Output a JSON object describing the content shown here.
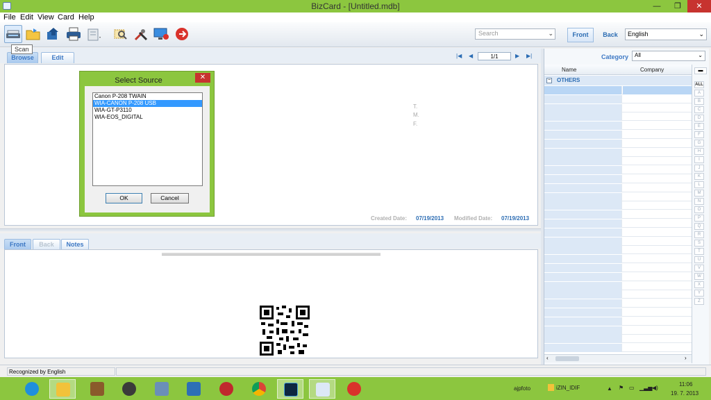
{
  "window": {
    "title": "BizCard - [Untitled.mdb]",
    "close_glyph": "✕",
    "minimize_glyph": "—",
    "maximize_glyph": "❐"
  },
  "menu": [
    "File",
    "Edit",
    "View",
    "Card",
    "Help"
  ],
  "toolbar": {
    "tooltip": "Scan",
    "search_placeholder": "Search",
    "front_label": "Front",
    "back_label": "Back",
    "language": "English"
  },
  "card_view": {
    "tabs": [
      "Browse",
      "Edit"
    ],
    "pager": "1/1",
    "field_labels": [
      "T.",
      "M.",
      "F."
    ],
    "created_label": "Created Date:",
    "created_value": "07/19/2013",
    "modified_label": "Modified Date:",
    "modified_value": "07/19/2013"
  },
  "bottom_tabs": [
    "Front",
    "Back",
    "Notes"
  ],
  "dialog": {
    "title": "Select Source",
    "sources": [
      "Canon P-208 TWAIN",
      "WIA-CANON P-208 USB",
      "WIA-GT-P3110",
      "WIA-EOS_DIGITAL"
    ],
    "selected_index": 1,
    "ok_label": "OK",
    "cancel_label": "Cancel"
  },
  "right_panel": {
    "category_label": "Category",
    "category_value": "All",
    "columns": [
      "Name",
      "Company"
    ],
    "group": "OTHERS",
    "alphabet": [
      "ALL",
      "A",
      "B",
      "C",
      "D",
      "E",
      "F",
      "G",
      "H",
      "I",
      "J",
      "K",
      "L",
      "M",
      "N",
      "O",
      "P",
      "Q",
      "R",
      "S",
      "T",
      "U",
      "V",
      "W",
      "X",
      "Y",
      "Z"
    ]
  },
  "status": {
    "text": "Recognized by English"
  },
  "taskbar": {
    "user": "ajpfoto",
    "folder": "iZIN_IDIF",
    "time": "11:06",
    "date": "19. 7. 2013"
  },
  "colors": {
    "accent_green": "#8cc63f",
    "link_blue": "#2b6cb3",
    "close_red": "#c7332f",
    "selection_blue": "#3399ff"
  }
}
